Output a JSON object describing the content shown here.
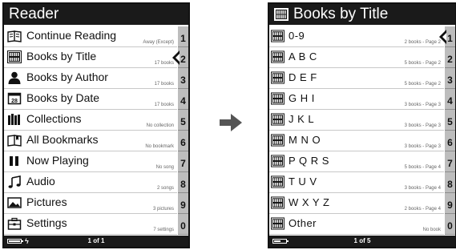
{
  "colors": {
    "bar": "#1a1a1a",
    "side_rail": "#bdbdbd",
    "divider": "#c8c8c8",
    "arrow": "#555555"
  },
  "left_screen": {
    "title": "Reader",
    "items": [
      {
        "label": "Continue Reading",
        "detail": "Away (Except)",
        "icon": "book-open-icon"
      },
      {
        "label": "Books by Title",
        "detail": "17 books",
        "icon": "books-grid-icon"
      },
      {
        "label": "Books by Author",
        "detail": "17 books",
        "icon": "person-icon"
      },
      {
        "label": "Books by Date",
        "detail": "17 books",
        "icon": "calendar-icon"
      },
      {
        "label": "Collections",
        "detail": "No collection",
        "icon": "collections-icon"
      },
      {
        "label": "All Bookmarks",
        "detail": "No bookmark",
        "icon": "bookmark-book-icon"
      },
      {
        "label": "Now Playing",
        "detail": "No song",
        "icon": "pause-icon"
      },
      {
        "label": "Audio",
        "detail": "2 songs",
        "icon": "music-note-icon"
      },
      {
        "label": "Pictures",
        "detail": "3 pictures",
        "icon": "picture-icon"
      },
      {
        "label": "Settings",
        "detail": "7 settings",
        "icon": "settings-icon"
      }
    ],
    "numbers": [
      "1",
      "2",
      "3",
      "4",
      "5",
      "6",
      "7",
      "8",
      "9",
      "0"
    ],
    "selected_index": 1,
    "page_indicator": "1 of 1",
    "battery_level": 1.0,
    "charge_glyph": "ϟ"
  },
  "right_screen": {
    "title": "Books by Title",
    "title_icon": "books-grid-icon",
    "items": [
      {
        "label": "0-9",
        "detail": "2 books - Page 2"
      },
      {
        "label": "A B C",
        "detail": "5 books - Page 2"
      },
      {
        "label": "D E F",
        "detail": "5 books - Page 2"
      },
      {
        "label": "G H I",
        "detail": "3 books - Page 3"
      },
      {
        "label": "J K L",
        "detail": "3 books - Page 3"
      },
      {
        "label": "M N O",
        "detail": "3 books - Page 3"
      },
      {
        "label": "P Q R S",
        "detail": "5 books - Page 4"
      },
      {
        "label": "T U V",
        "detail": "3 books - Page 4"
      },
      {
        "label": "W X Y Z",
        "detail": "2 books - Page 4"
      },
      {
        "label": "Other",
        "detail": "No book"
      }
    ],
    "numbers": [
      "1",
      "2",
      "3",
      "4",
      "5",
      "6",
      "7",
      "8",
      "9",
      "0"
    ],
    "selected_index": 0,
    "page_indicator": "1 of 5",
    "battery_level": 0.6
  },
  "transition_arrow": "right-arrow-icon"
}
